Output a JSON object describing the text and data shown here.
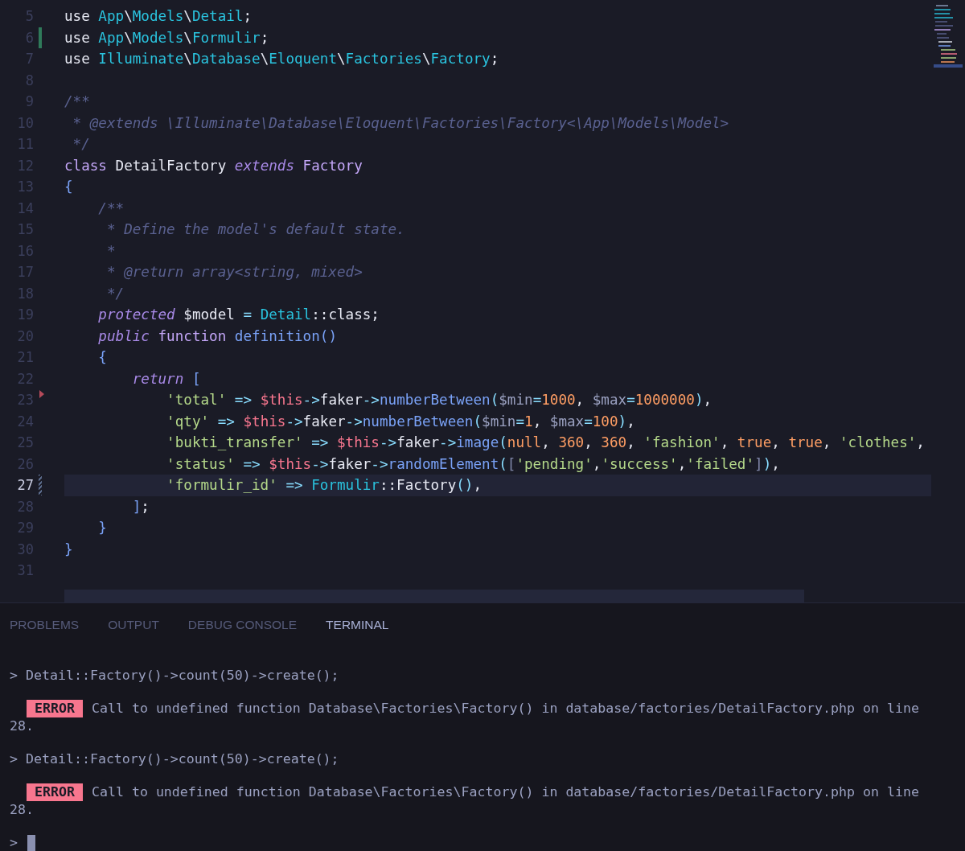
{
  "editor": {
    "lines": [
      {
        "number": "5",
        "current": false,
        "kind": "plain",
        "tokens": [
          {
            "text": "use",
            "kind": "keyword"
          },
          {
            "text": " App",
            "kind": "namespace"
          },
          {
            "text": "\\",
            "kind": "plain"
          },
          {
            "text": "Models",
            "kind": "namespace"
          },
          {
            "text": "\\",
            "kind": "plain"
          },
          {
            "text": "Detail",
            "kind": "namespace"
          },
          {
            "text": ";",
            "kind": "plain"
          }
        ]
      },
      {
        "number": "6",
        "current": false,
        "kind": "added",
        "tokens": [
          {
            "text": "use",
            "kind": "keyword"
          },
          {
            "text": " App",
            "kind": "namespace"
          },
          {
            "text": "\\",
            "kind": "plain"
          },
          {
            "text": "Models",
            "kind": "namespace"
          },
          {
            "text": "\\",
            "kind": "plain"
          },
          {
            "text": "Formulir",
            "kind": "namespace"
          },
          {
            "text": ";",
            "kind": "plain"
          }
        ]
      },
      {
        "number": "7",
        "current": false,
        "kind": "plain",
        "tokens": [
          {
            "text": "use",
            "kind": "keyword"
          },
          {
            "text": " Illuminate",
            "kind": "namespace"
          },
          {
            "text": "\\",
            "kind": "plain"
          },
          {
            "text": "Database",
            "kind": "namespace"
          },
          {
            "text": "\\",
            "kind": "plain"
          },
          {
            "text": "Eloquent",
            "kind": "namespace"
          },
          {
            "text": "\\",
            "kind": "plain"
          },
          {
            "text": "Factories",
            "kind": "namespace"
          },
          {
            "text": "\\",
            "kind": "plain"
          },
          {
            "text": "Factory",
            "kind": "namespace"
          },
          {
            "text": ";",
            "kind": "plain"
          }
        ]
      },
      {
        "number": "8",
        "current": false,
        "kind": "plain"
      },
      {
        "number": "9",
        "current": false,
        "kind": "plain",
        "tokens": [
          {
            "text": "/**",
            "kind": "comment"
          }
        ]
      },
      {
        "number": "10",
        "current": false,
        "kind": "plain",
        "tokens": [
          {
            "text": " * @extends \\Illuminate\\Database\\Eloquent\\Factories\\Factory<\\App\\Models\\Model>",
            "kind": "comment"
          }
        ]
      },
      {
        "number": "11",
        "current": false,
        "kind": "plain",
        "tokens": [
          {
            "text": " */",
            "kind": "comment"
          }
        ]
      },
      {
        "number": "12",
        "current": false,
        "kind": "plain",
        "tokens": [
          {
            "text": "class",
            "kind": "storage"
          },
          {
            "text": " DetailFactory",
            "kind": "plain"
          },
          {
            "text": " extends",
            "kind": "modifier"
          },
          {
            "text": " Factory",
            "kind": "storage"
          }
        ]
      },
      {
        "number": "13",
        "current": false,
        "kind": "plain",
        "tokens": [
          {
            "text": "{",
            "kind": "brace"
          }
        ]
      },
      {
        "number": "14",
        "current": false,
        "kind": "plain",
        "tokens": [
          {
            "text": "    /**",
            "kind": "comment"
          }
        ]
      },
      {
        "number": "15",
        "current": false,
        "kind": "plain",
        "tokens": [
          {
            "text": "     * Define the model's default state.",
            "kind": "comment"
          }
        ]
      },
      {
        "number": "16",
        "current": false,
        "kind": "plain",
        "tokens": [
          {
            "text": "     *",
            "kind": "comment"
          }
        ]
      },
      {
        "number": "17",
        "current": false,
        "kind": "plain",
        "tokens": [
          {
            "text": "     * @return array<string, mixed>",
            "kind": "comment"
          }
        ]
      },
      {
        "number": "18",
        "current": false,
        "kind": "plain",
        "tokens": [
          {
            "text": "     */",
            "kind": "comment"
          }
        ]
      },
      {
        "number": "19",
        "current": false,
        "kind": "plain",
        "tokens": [
          {
            "text": "    protected",
            "kind": "modifier"
          },
          {
            "text": " $model",
            "kind": "plain"
          },
          {
            "text": " =",
            "kind": "operator"
          },
          {
            "text": " Detail",
            "kind": "namespace"
          },
          {
            "text": "::class;",
            "kind": "plain"
          }
        ]
      },
      {
        "number": "20",
        "current": false,
        "kind": "plain",
        "tokens": [
          {
            "text": "    public",
            "kind": "modifier"
          },
          {
            "text": " function",
            "kind": "storage"
          },
          {
            "text": " definition",
            "kind": "function"
          },
          {
            "text": "()",
            "kind": "brace"
          }
        ]
      },
      {
        "number": "21",
        "current": false,
        "kind": "plain",
        "tokens": [
          {
            "text": "    {",
            "kind": "brace"
          }
        ]
      },
      {
        "number": "22",
        "current": false,
        "kind": "plain",
        "tokens": [
          {
            "text": "        return",
            "kind": "modifier"
          },
          {
            "text": " [",
            "kind": "brace"
          }
        ]
      },
      {
        "number": "23",
        "current": false,
        "kind": "deleted",
        "tokens": [
          {
            "text": "            'total'",
            "kind": "string"
          },
          {
            "text": " =>",
            "kind": "operator"
          },
          {
            "text": " $this",
            "kind": "this"
          },
          {
            "text": "->",
            "kind": "operator"
          },
          {
            "text": "faker",
            "kind": "plain"
          },
          {
            "text": "->",
            "kind": "operator"
          },
          {
            "text": "numberBetween",
            "kind": "function"
          },
          {
            "text": "(",
            "kind": "operator"
          },
          {
            "text": "$min",
            "kind": "parameter"
          },
          {
            "text": "=",
            "kind": "operator"
          },
          {
            "text": "1000",
            "kind": "number"
          },
          {
            "text": ",",
            "kind": "plain"
          },
          {
            "text": " $max",
            "kind": "parameter"
          },
          {
            "text": "=",
            "kind": "operator"
          },
          {
            "text": "1000000",
            "kind": "number"
          },
          {
            "text": ")",
            "kind": "operator"
          },
          {
            "text": ",",
            "kind": "plain"
          }
        ]
      },
      {
        "number": "24",
        "current": false,
        "kind": "plain",
        "tokens": [
          {
            "text": "            'qty'",
            "kind": "string"
          },
          {
            "text": " =>",
            "kind": "operator"
          },
          {
            "text": " $this",
            "kind": "this"
          },
          {
            "text": "->",
            "kind": "operator"
          },
          {
            "text": "faker",
            "kind": "plain"
          },
          {
            "text": "->",
            "kind": "operator"
          },
          {
            "text": "numberBetween",
            "kind": "function"
          },
          {
            "text": "(",
            "kind": "operator"
          },
          {
            "text": "$min",
            "kind": "parameter"
          },
          {
            "text": "=",
            "kind": "operator"
          },
          {
            "text": "1",
            "kind": "number"
          },
          {
            "text": ",",
            "kind": "plain"
          },
          {
            "text": " $max",
            "kind": "parameter"
          },
          {
            "text": "=",
            "kind": "operator"
          },
          {
            "text": "100",
            "kind": "number"
          },
          {
            "text": ")",
            "kind": "operator"
          },
          {
            "text": ",",
            "kind": "plain"
          }
        ]
      },
      {
        "number": "25",
        "current": false,
        "kind": "plain",
        "tokens": [
          {
            "text": "            'bukti_transfer'",
            "kind": "string"
          },
          {
            "text": " =>",
            "kind": "operator"
          },
          {
            "text": " $this",
            "kind": "this"
          },
          {
            "text": "->",
            "kind": "operator"
          },
          {
            "text": "faker",
            "kind": "plain"
          },
          {
            "text": "->",
            "kind": "operator"
          },
          {
            "text": "image",
            "kind": "function"
          },
          {
            "text": "(",
            "kind": "operator"
          },
          {
            "text": "null",
            "kind": "number"
          },
          {
            "text": ",",
            "kind": "plain"
          },
          {
            "text": " 360",
            "kind": "number"
          },
          {
            "text": ",",
            "kind": "plain"
          },
          {
            "text": " 360",
            "kind": "number"
          },
          {
            "text": ",",
            "kind": "plain"
          },
          {
            "text": " 'fashion'",
            "kind": "string"
          },
          {
            "text": ",",
            "kind": "plain"
          },
          {
            "text": " true",
            "kind": "number"
          },
          {
            "text": ",",
            "kind": "plain"
          },
          {
            "text": " true",
            "kind": "number"
          },
          {
            "text": ",",
            "kind": "plain"
          },
          {
            "text": " 'clothes'",
            "kind": "string"
          },
          {
            "text": ",",
            "kind": "plain"
          }
        ]
      },
      {
        "number": "26",
        "current": false,
        "kind": "plain",
        "tokens": [
          {
            "text": "            'status'",
            "kind": "string"
          },
          {
            "text": " =>",
            "kind": "operator"
          },
          {
            "text": " $this",
            "kind": "this"
          },
          {
            "text": "->",
            "kind": "operator"
          },
          {
            "text": "faker",
            "kind": "plain"
          },
          {
            "text": "->",
            "kind": "operator"
          },
          {
            "text": "randomElement",
            "kind": "function"
          },
          {
            "text": "(",
            "kind": "operator"
          },
          {
            "text": "[",
            "kind": "bracket"
          },
          {
            "text": "'pending'",
            "kind": "string"
          },
          {
            "text": ",",
            "kind": "plain"
          },
          {
            "text": "'success'",
            "kind": "string"
          },
          {
            "text": ",",
            "kind": "plain"
          },
          {
            "text": "'failed'",
            "kind": "string"
          },
          {
            "text": "]",
            "kind": "bracket"
          },
          {
            "text": ")",
            "kind": "operator"
          },
          {
            "text": ",",
            "kind": "plain"
          }
        ]
      },
      {
        "number": "27",
        "current": true,
        "kind": "modified",
        "tokens": [
          {
            "text": "            'formulir_id'",
            "kind": "string"
          },
          {
            "text": " =>",
            "kind": "operator"
          },
          {
            "text": " Formulir",
            "kind": "namespace"
          },
          {
            "text": "::Factory",
            "kind": "plain"
          },
          {
            "text": "()",
            "kind": "operator"
          },
          {
            "text": ",",
            "kind": "plain"
          }
        ]
      },
      {
        "number": "28",
        "current": false,
        "kind": "plain",
        "tokens": [
          {
            "text": "        ]",
            "kind": "brace"
          },
          {
            "text": ";",
            "kind": "plain"
          }
        ]
      },
      {
        "number": "29",
        "current": false,
        "kind": "plain",
        "tokens": [
          {
            "text": "    }",
            "kind": "brace"
          }
        ]
      },
      {
        "number": "30",
        "current": false,
        "kind": "plain",
        "tokens": [
          {
            "text": "}",
            "kind": "brace"
          }
        ]
      },
      {
        "number": "31",
        "current": false,
        "kind": "plain"
      }
    ]
  },
  "panel": {
    "tabs": [
      {
        "label": "PROBLEMS",
        "selected": false
      },
      {
        "label": "OUTPUT",
        "selected": false
      },
      {
        "label": "DEBUG CONSOLE",
        "selected": false
      },
      {
        "label": "TERMINAL",
        "selected": true
      }
    ],
    "terminal": [
      {
        "kind": "command",
        "text": "> Detail::Factory()->count(50)->create();"
      },
      {
        "kind": "error",
        "badge": "ERROR",
        "text": "Call to undefined function Database\\Factories\\Factory() in database/factories/DetailFactory.php on line",
        "wrap": "28."
      },
      {
        "kind": "command",
        "text": "> Detail::Factory()->count(50)->create();"
      },
      {
        "kind": "error",
        "badge": "ERROR",
        "text": "Call to undefined function Database\\Factories\\Factory() in database/factories/DetailFactory.php on line",
        "wrap": "28."
      },
      {
        "kind": "prompt",
        "text": ">"
      }
    ]
  }
}
